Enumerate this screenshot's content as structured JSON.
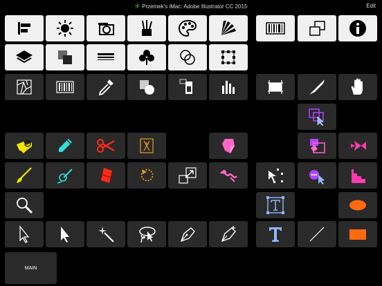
{
  "header": {
    "title": "Przemek's iMac: Adobe Illustrator CC 2015",
    "edit_label": "Edit"
  },
  "main_button": {
    "label": "MAIN"
  },
  "colors": {
    "background": "#000000",
    "light_button": "#f0f0f0",
    "dark_button": "#2a2a2a",
    "yellow": "#f2e600",
    "cyan": "#2ee0d8",
    "red": "#ff2a1a",
    "orange": "#ff6a10",
    "pink": "#ff66c8",
    "purple": "#b044ff",
    "blue_type": "#8fb8ff"
  },
  "tools": [
    "align-icon",
    "sun-icon",
    "camera-icon",
    "brushes-icon",
    "palette-icon",
    "swatch-fan-icon",
    "barcode-icon",
    "artboards-icon",
    "info-icon",
    "layers-icon",
    "transparency-icon",
    "stroke-icon",
    "symbols-icon",
    "pathfinder-icon",
    "transform-icon",
    "live-paint-icon",
    "barcode-icon",
    "eyedropper-icon",
    "shape-builder-icon",
    "jpeg-export-icon",
    "graph-icon",
    "crop-icon",
    "knife-icon",
    "hand-icon",
    "perspective-icon",
    "live-paint-bucket-icon",
    "pencil-icon",
    "scissors-icon",
    "blend-icon",
    "eraser-icon",
    "live-paint-select-icon",
    "fish-warp-icon",
    "paintbrush-icon",
    "blob-brush-icon",
    "eraser-tool-icon",
    "rotate-icon",
    "scale-icon",
    "warp-icon",
    "free-transform-icon",
    "puppet-icon",
    "column-graph-icon",
    "zoom-icon",
    "area-type-icon",
    "ellipse-icon",
    "selection-arrow-icon",
    "direct-select-icon",
    "magic-wand-icon",
    "lasso-icon",
    "pen-icon",
    "add-anchor-icon",
    "type-icon",
    "line-segment-icon",
    "rectangle-icon"
  ]
}
